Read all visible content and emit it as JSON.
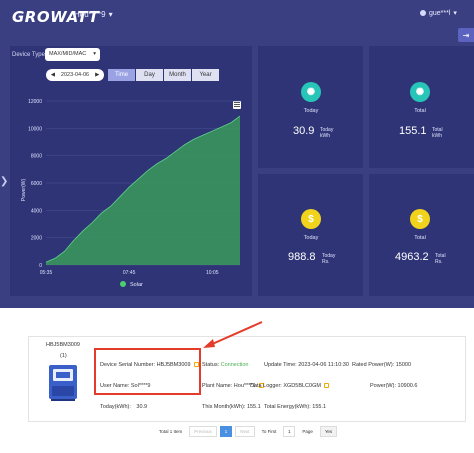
{
  "header": {
    "logo": "GROWATT",
    "plant_name": "Hou****9",
    "user_name": "gue***l"
  },
  "controls": {
    "device_type_label": "Device Type",
    "device_type_value": "MAX/MID/MAC",
    "date": "2023-04-06",
    "tabs": [
      "Time",
      "Day",
      "Month",
      "Year"
    ],
    "active_tab": "Time"
  },
  "chart_data": {
    "type": "area",
    "ylabel": "Power(W)",
    "y_ticks": [
      0,
      2000,
      4000,
      6000,
      8000,
      10000,
      12000
    ],
    "x_ticks": [
      "05:35",
      "07:45",
      "10:05"
    ],
    "ylim": [
      0,
      12000
    ],
    "legend": "Solar",
    "color": "#3a9a5c",
    "x": [
      "05:35",
      "05:50",
      "06:05",
      "06:20",
      "06:35",
      "06:50",
      "07:05",
      "07:20",
      "07:35",
      "07:45",
      "08:00",
      "08:15",
      "08:30",
      "08:45",
      "09:00",
      "09:15",
      "09:30",
      "09:45",
      "10:05",
      "10:20",
      "10:35",
      "10:50"
    ],
    "values": [
      200,
      500,
      1000,
      1800,
      2500,
      3100,
      3800,
      4300,
      5000,
      5700,
      6300,
      6900,
      7400,
      7800,
      8300,
      8800,
      9200,
      9500,
      9800,
      10100,
      10400,
      10900
    ]
  },
  "stats": {
    "energy_today_label": "Today",
    "energy_today_value": "30.9",
    "energy_today_unit_1": "Today",
    "energy_today_unit_2": "kWh",
    "energy_total_label": "Total",
    "energy_total_value": "155.1",
    "energy_total_unit_1": "Total",
    "energy_total_unit_2": "kWh",
    "revenue_today_label": "Today",
    "revenue_today_value": "988.8",
    "revenue_today_unit_1": "Today",
    "revenue_today_unit_2": "Rs.",
    "revenue_total_label": "Total",
    "revenue_total_value": "4963.2",
    "revenue_total_unit_1": "Total",
    "revenue_total_unit_2": "Rs.",
    "icon_energy_color": "#27c4b8",
    "icon_money_color": "#f2d31b"
  },
  "device": {
    "title": "HBJ5BM3009",
    "index": "(1)",
    "serial_label": "Device Serial Number:",
    "serial_value": "HBJ5BM3009",
    "user_label": "User Name:",
    "user_value": "Sol****9",
    "today_label": "Today(kWh):",
    "today_value": "30.9",
    "status_label": "Status:",
    "status_value": "Connection",
    "plant_label": "Plant Name:",
    "plant_value": "Hou****9",
    "month_label": "This Month(kWh):",
    "month_value": "155.1",
    "update_label": "Update Time:",
    "update_value": "2023-04-06 11:10:30",
    "logger_label": "Data Logger:",
    "logger_value": "XGD5BLC0GM",
    "total_label": "Total Energy(kWh):",
    "total_value": "155.1",
    "rated_label": "Rated Power(W):",
    "rated_value": "15000",
    "comm_label": "Power(W):",
    "comm_value": "10900.6"
  },
  "pagination": {
    "total": "Total 1 Item",
    "previous": "Previous",
    "current": "1",
    "next": "Next",
    "to_first": "To First",
    "input_value": "1",
    "page": "Page",
    "yes": "Yes"
  },
  "annotation": {
    "arrow_color": "#e53b2a"
  }
}
